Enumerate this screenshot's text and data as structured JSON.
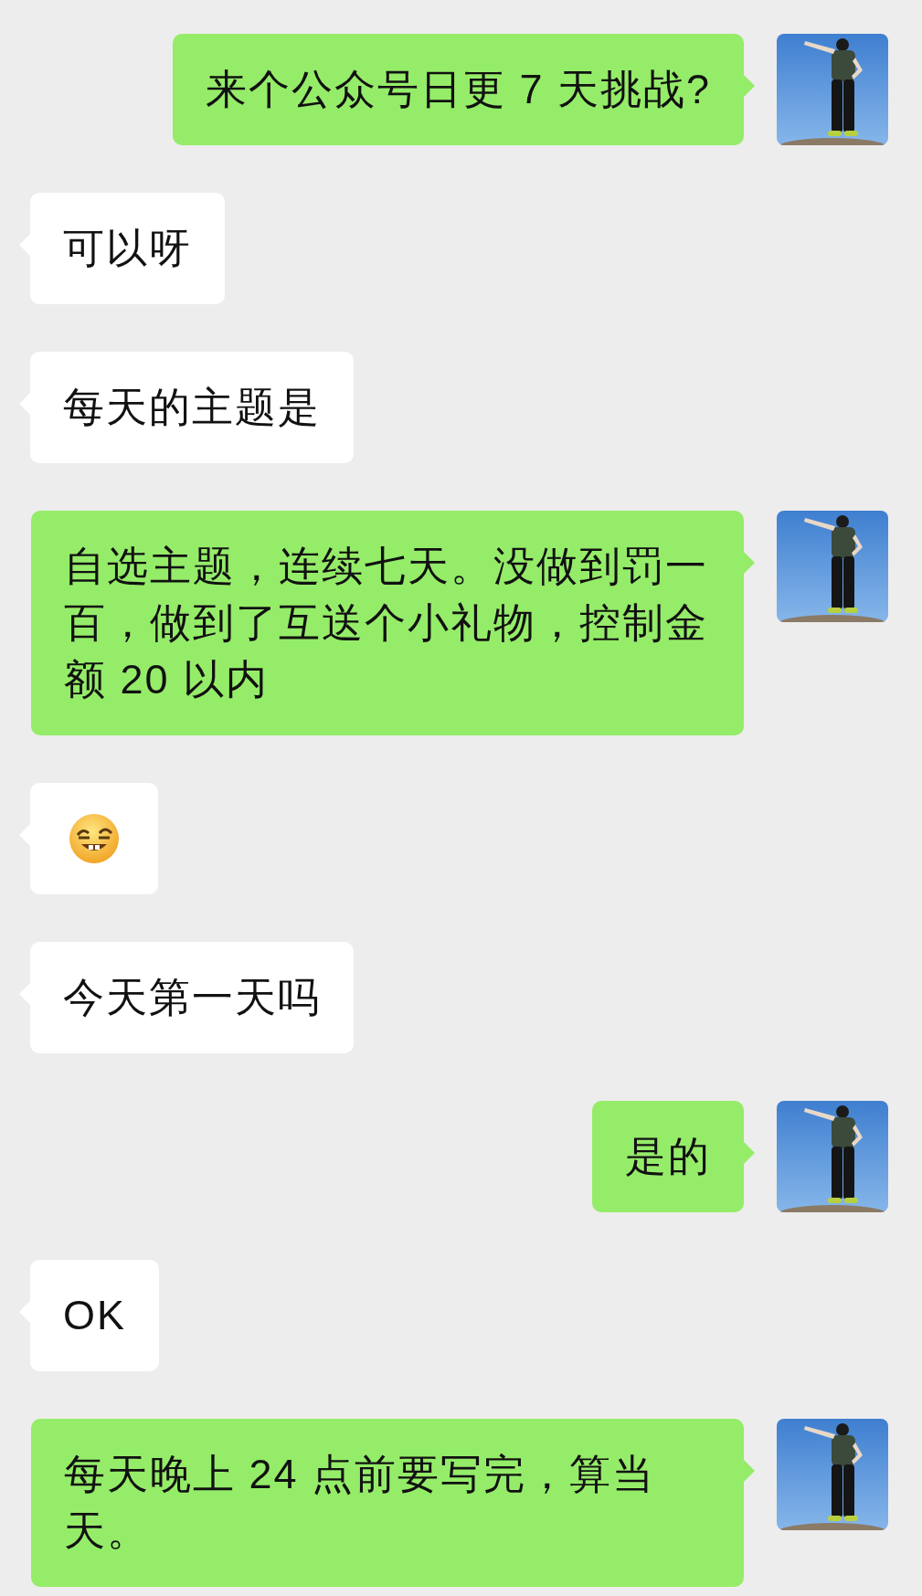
{
  "messages": [
    {
      "outgoing": true,
      "kind": "text",
      "text": "来个公众号日更 7 天挑战?"
    },
    {
      "outgoing": false,
      "kind": "text",
      "text": "可以呀"
    },
    {
      "outgoing": false,
      "kind": "text",
      "text": "每天的主题是"
    },
    {
      "outgoing": true,
      "kind": "text",
      "text": "自选主题，连续七天。没做到罚一百，做到了互送个小礼物，控制金额 20 以内"
    },
    {
      "outgoing": false,
      "kind": "emoji"
    },
    {
      "outgoing": false,
      "kind": "text",
      "text": "今天第一天吗"
    },
    {
      "outgoing": true,
      "kind": "text",
      "text": "是的"
    },
    {
      "outgoing": false,
      "kind": "text",
      "text": "OK"
    },
    {
      "outgoing": true,
      "kind": "text",
      "text": "每天晚上 24 点前要写完，算当天。"
    }
  ]
}
